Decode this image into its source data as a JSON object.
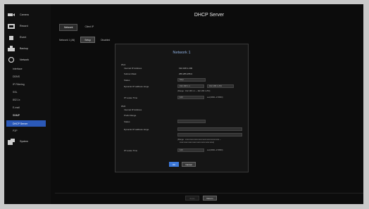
{
  "sidebar": {
    "main": [
      {
        "label": "Camera",
        "icon": "camera-icon"
      },
      {
        "label": "Record",
        "icon": "record-icon"
      },
      {
        "label": "Event",
        "icon": "event-icon"
      },
      {
        "label": "Backup",
        "icon": "backup-icon"
      },
      {
        "label": "Network",
        "icon": "network-icon"
      }
    ],
    "network_sub": [
      "Interface",
      "DDNS",
      "IP Filtering",
      "SSL",
      "802.1x",
      "E-mail",
      "SNMP",
      "DHCP Server",
      "P2P"
    ],
    "active_sub": "DHCP Server",
    "system": {
      "label": "System",
      "icon": "system-icon"
    }
  },
  "page": {
    "title": "DHCP Server"
  },
  "tabs": [
    {
      "label": "Network",
      "active": true
    },
    {
      "label": "Client IP",
      "active": false
    }
  ],
  "network_row": {
    "label": "Network 1 (All)",
    "setup": "Setup",
    "status": "Disabled"
  },
  "panel": {
    "title": "Network 1",
    "ipv4": {
      "section": "IPv4",
      "internal_ip_label": "Internal IP Address",
      "internal_ip": "192.168.1.200",
      "subnet_label": "Subnet Mask",
      "subnet": "255.255.255.0",
      "status_label": "Status",
      "status": "Stop",
      "range_label": "Dynamic IP address range",
      "range_from": "192.168.1.1",
      "range_to": "192.168.1.254",
      "range_note": "(Range : 192.168.1.1 ~ 192.168.1.254)",
      "lease_label": "IP Lease Time",
      "lease": "120",
      "lease_unit": "sec(3600~172800)"
    },
    "ipv6": {
      "section": "IPv6",
      "internal_ip_label": "Internal IP Address",
      "prefix_label": "Prefix Range",
      "status_label": "Status",
      "range_label": "Dynamic IP address range",
      "range_note_1": "(Range : xxxx:xxxx:xxxx:xxxx:xxxx:xxxx:xxxx:xxxx ~",
      "range_note_2": "xxxx:xxxx:xxxx:xxxx:xxxx:xxxx:xxxx:xxxx)",
      "lease_label": "IP Lease Time",
      "lease": "120",
      "lease_unit": "sec(3600~172800)"
    },
    "ok": "OK",
    "cancel": "Cancel"
  },
  "footer": {
    "apply": "Apply",
    "return": "Return"
  },
  "colors": {
    "accent": "#3c78d8",
    "active_nav": "#2b59b8",
    "panel_title": "#8fb0e0"
  }
}
